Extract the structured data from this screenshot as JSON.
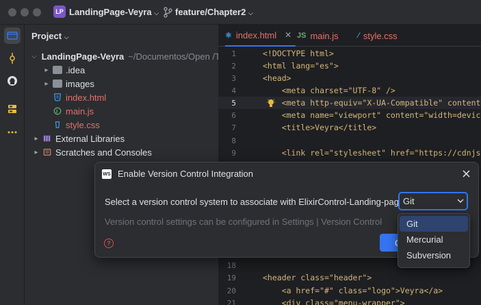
{
  "titlebar": {
    "project_badge": "LP",
    "project_name": "LandingPage-Veyra",
    "branch_name": "feature/Chapter2"
  },
  "project_panel": {
    "title": "Project",
    "tree": [
      {
        "label": "LandingPage-Veyra",
        "note": "~/Documentos/Open /Tra",
        "depth": 0,
        "expanded": true,
        "kind": "folder"
      },
      {
        "label": ".idea",
        "depth": 1,
        "expanded": false,
        "kind": "folder"
      },
      {
        "label": "images",
        "depth": 1,
        "expanded": false,
        "kind": "folder"
      },
      {
        "label": "index.html",
        "depth": 1,
        "kind": "html",
        "color": "#e0736c"
      },
      {
        "label": "main.js",
        "depth": 1,
        "kind": "js",
        "color": "#e0736c"
      },
      {
        "label": "style.css",
        "depth": 1,
        "kind": "css",
        "color": "#e0736c"
      },
      {
        "label": "External Libraries",
        "depth": 0,
        "expanded": false,
        "kind": "lib"
      },
      {
        "label": "Scratches and Consoles",
        "depth": 0,
        "expanded": false,
        "kind": "scratch"
      }
    ]
  },
  "tabs": [
    {
      "label": "index.html",
      "icon": "html-icon",
      "color": "#e0736c",
      "active": true
    },
    {
      "label": "main.js",
      "icon": "js-icon",
      "color": "#e0736c",
      "active": false
    },
    {
      "label": "style.css",
      "icon": "css-icon",
      "color": "#e0736c",
      "active": false
    }
  ],
  "editor": {
    "current_line": 5,
    "lines": [
      {
        "n": "1",
        "code": "<!DOCTYPE html>"
      },
      {
        "n": "2",
        "code": "<html lang=\"es\">"
      },
      {
        "n": "3",
        "code": "<head>"
      },
      {
        "n": "4",
        "code": "    <meta charset=\"UTF-8\" />"
      },
      {
        "n": "5",
        "code": "    <meta http-equiv=\"X-UA-Compatible\" content=\"I"
      },
      {
        "n": "6",
        "code": "    <meta name=\"viewport\" content=\"width=device-w"
      },
      {
        "n": "7",
        "code": "    <title>Veyra</title>"
      },
      {
        "n": "8",
        "code": ""
      },
      {
        "n": "9",
        "code": "    <link rel=\"stylesheet\" href=\"https://cdnjs.cl"
      }
    ],
    "lines_bottom": [
      {
        "n": "18",
        "code": ""
      },
      {
        "n": "19",
        "code": "<header class=\"header\">"
      },
      {
        "n": "20",
        "code": "    <a href=\"#\" class=\"logo\">Veyra</a>"
      },
      {
        "n": "21",
        "code": "    <div class=\"menu-wrapper\">"
      }
    ]
  },
  "dialog": {
    "icon_text": "WS",
    "title": "Enable Version Control Integration",
    "prompt": "Select a version control system to associate with ElixirControl-Landing-page:",
    "hint": "Version control settings can be configured in Settings | Version Control",
    "selected_vcs": "Git",
    "ok_label": "OK",
    "help_label": "?"
  },
  "vcs_options": [
    "Git",
    "Mercurial",
    "Subversion"
  ],
  "colors": {
    "accent": "#3574f0",
    "background": "#1e1f22",
    "panel": "#2b2d30",
    "modified_file": "#e0736c"
  }
}
